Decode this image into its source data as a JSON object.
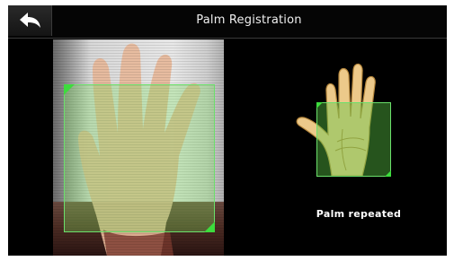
{
  "header": {
    "title": "Palm Registration",
    "back_icon": "back-arrow-icon"
  },
  "main": {
    "status_text": "Palm repeated",
    "accent_color": "#3ddc3d"
  }
}
